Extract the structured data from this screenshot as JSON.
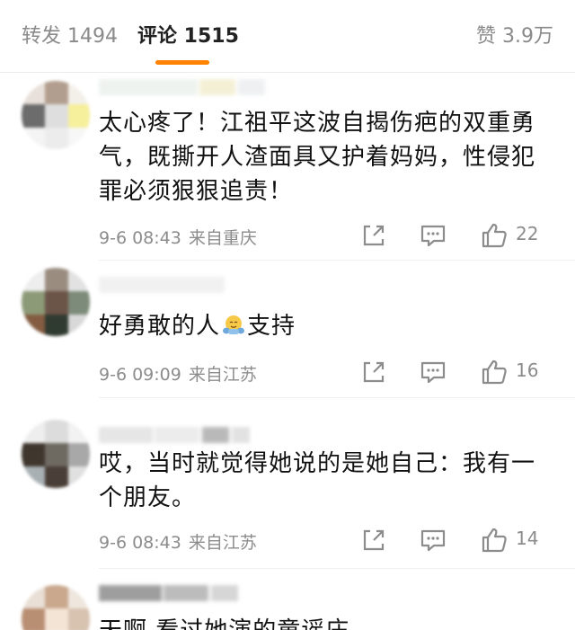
{
  "tabs": {
    "repost": "转发 1494",
    "comments": "评论 1515",
    "likes": "赞 3.9万"
  },
  "colors": {
    "accent": "#ff8200",
    "meta": "#8c8c8c"
  },
  "comments": [
    {
      "text": "太心疼了！江祖平这波自揭伤疤的双重勇气，既撕开人渣面具又护着妈妈，性侵犯罪必须狠狠追责！",
      "time": "9-6 08:43",
      "location": "来自重庆",
      "likes": "22"
    },
    {
      "text_before": "好勇敢的人",
      "emoji": "hug-emoji",
      "text_after": "支持",
      "time": "9-6 09:09",
      "location": "来自江苏",
      "likes": "16"
    },
    {
      "text": "哎，当时就觉得她说的是她自己：我有一个朋友。",
      "time": "9-6 08:43",
      "location": "来自江苏",
      "likes": "14"
    },
    {
      "text": "天啊 看过她演的童谣庄"
    }
  ],
  "icons": {
    "share": "share-icon",
    "reply": "comment-icon",
    "like": "thumbs-up-icon"
  }
}
